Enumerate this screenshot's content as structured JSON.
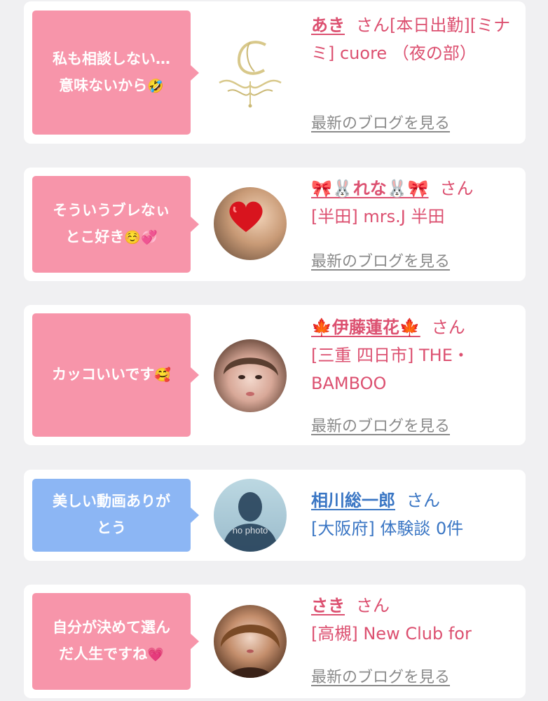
{
  "posts": [
    {
      "comment_line1": "私も相談しない…",
      "comment_line2": "意味ないから",
      "comment_emoji": "🤣",
      "name": "あき",
      "san": "さん",
      "detail": "[本日出勤][ミナミ] cuore （夜の部）",
      "blog_link": "最新のブログを見る"
    },
    {
      "comment_line1": "そういうブレなぃ",
      "comment_line2": "とこ好き",
      "comment_emoji": "☺️💞",
      "name": "🎀🐰れな🐰🎀",
      "san": "さん",
      "detail": "[半田] mrs.J 半田",
      "blog_link": "最新のブログを見る"
    },
    {
      "comment_line1": "カッコいいです",
      "comment_line2": "",
      "comment_emoji": "🥰",
      "name": "🍁伊藤蓮花🍁",
      "san": "さん",
      "detail": "[三重 四日市] THE・BAMBOO",
      "blog_link": "最新のブログを見る"
    },
    {
      "comment_line1": "美しい動画ありが",
      "comment_line2": "とう",
      "comment_emoji": "",
      "name": "相川総一郎",
      "san": "さん",
      "detail": "[大阪府] 体験談 0件",
      "avatar_text": "no photo"
    },
    {
      "comment_line1": "自分が決めて選ん",
      "comment_line2": "だ人生ですね",
      "comment_emoji": "💗",
      "name": "さき",
      "san": "さん",
      "detail": "[高槻] New Club for",
      "blog_link": "最新のブログを見る"
    }
  ],
  "colors": {
    "pink_bubble": "#f795aa",
    "blue_bubble": "#8cb6f4",
    "pink_text": "#dc5070",
    "blue_text": "#3a76c4"
  }
}
